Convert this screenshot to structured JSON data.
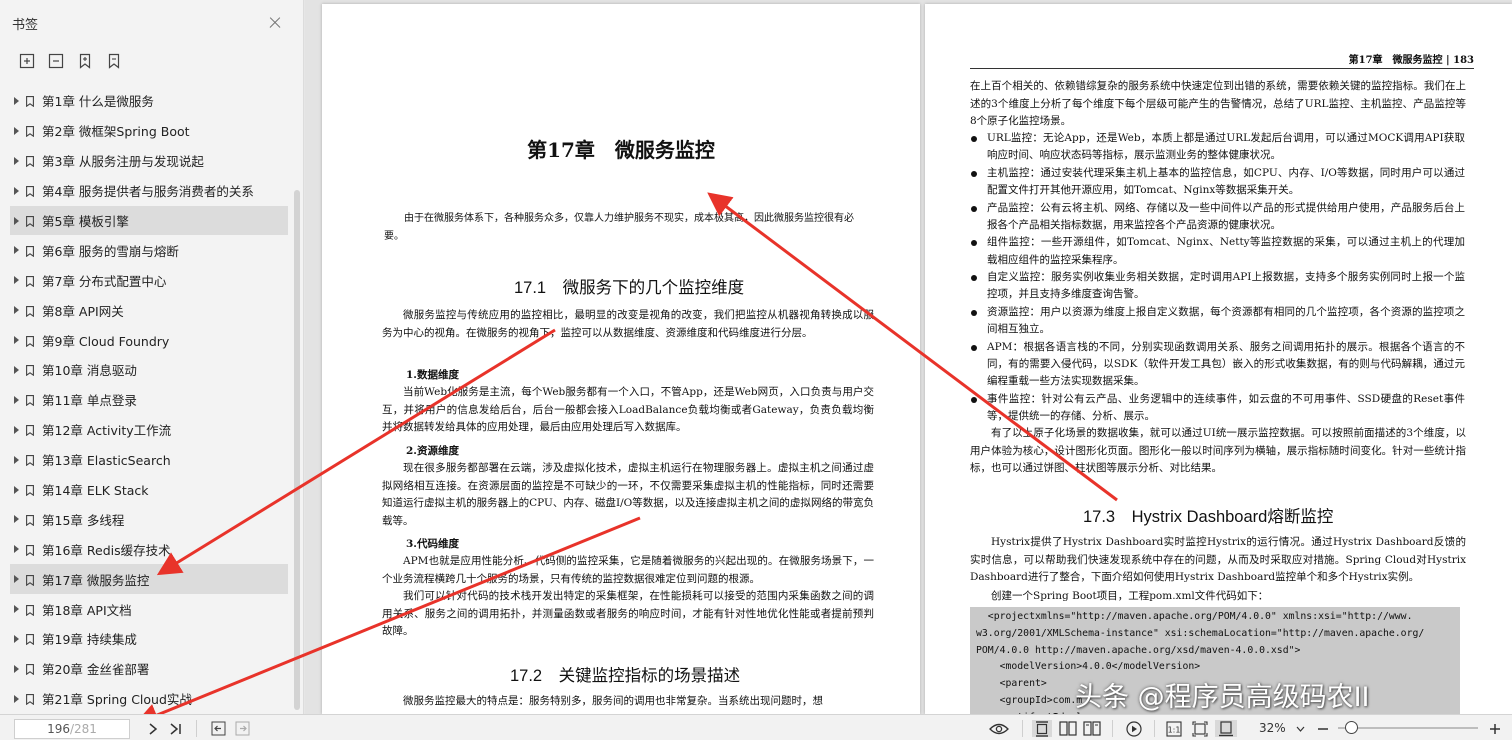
{
  "sidebar": {
    "title": "书签",
    "items": [
      {
        "label": "第1章 什么是微服务"
      },
      {
        "label": "第2章 微框架Spring Boot"
      },
      {
        "label": "第3章 从服务注册与发现说起"
      },
      {
        "label": "第4章 服务提供者与服务消费者的关系"
      },
      {
        "label": "第5章 模板引擎"
      },
      {
        "label": "第6章 服务的雪崩与熔断"
      },
      {
        "label": "第7章 分布式配置中心"
      },
      {
        "label": "第8章 API网关"
      },
      {
        "label": "第9章 Cloud Foundry"
      },
      {
        "label": "第10章 消息驱动"
      },
      {
        "label": "第11章 单点登录"
      },
      {
        "label": "第12章 Activity工作流"
      },
      {
        "label": "第13章 ElasticSearch"
      },
      {
        "label": "第14章 ELK Stack"
      },
      {
        "label": "第15章 多线程"
      },
      {
        "label": "第16章 Redis缓存技术"
      },
      {
        "label": "第17章 微服务监控"
      },
      {
        "label": "第18章 API文档"
      },
      {
        "label": "第19章 持续集成"
      },
      {
        "label": "第20章 金丝雀部署"
      },
      {
        "label": "第21章 Spring Cloud实战"
      }
    ]
  },
  "left_page": {
    "chapter_title": "第17章　微服务监控",
    "abstract": "由于在微服务体系下，各种服务众多，仅靠人力维护服务不现实，成本极其高，因此微服务监控很有必要。",
    "s1_title": "17.1　微服务下的几个监控维度",
    "s1_intro": "微服务监控与传统应用的监控相比，最明显的改变是视角的改变，我们把监控从机器视角转换成以服务为中心的视角。在微服务的视角下，监控可以从数据维度、资源维度和代码维度进行分层。",
    "sub1_title": "1.数据维度",
    "sub1_text": "当前Web化服务是主流，每个Web服务都有一个入口，不管App，还是Web网页，入口负责与用户交互，并将用户的信息发给后台，后台一般都会接入LoadBalance负载均衡或者Gateway，负责负载均衡并将数据转发给具体的应用处理，最后由应用处理后写入数据库。",
    "sub2_title": "2.资源维度",
    "sub2_text": "现在很多服务都部署在云端，涉及虚拟化技术，虚拟主机运行在物理服务器上。虚拟主机之间通过虚拟网络相互连接。在资源层面的监控是不可缺少的一环，不仅需要采集虚拟主机的性能指标，同时还需要知道运行虚拟主机的服务器上的CPU、内存、磁盘I/O等数据，以及连接虚拟主机之间的虚拟网络的带宽负载等。",
    "sub3_title": "3.代码维度",
    "sub3_text1": "APM也就是应用性能分析、代码侧的监控采集，它是随着微服务的兴起出现的。在微服务场景下，一个业务流程横跨几十个服务的场景，只有传统的监控数据很难定位到问题的根源。",
    "sub3_text2": "我们可以针对代码的技术栈开发出特定的采集框架，在性能损耗可以接受的范围内采集函数之间的调用关系、服务之间的调用拓扑，并测量函数或者服务的响应时间，才能有针对性地优化性能或者提前预判故障。",
    "s2_title": "17.2　关键监控指标的场景描述",
    "s2_text": "微服务监控最大的特点是：服务特别多，服务间的调用也非常复杂。当系统出现问题时，想"
  },
  "right_page": {
    "header": "第17章　微服务监控 | 183",
    "intro": "在上百个相关的、依赖错综复杂的服务系统中快速定位到出错的系统，需要依赖关键的监控指标。我们在上述的3个维度上分析了每个维度下每个层级可能产生的告警情况，总结了URL监控、主机监控、产品监控等8个原子化监控场景。",
    "bullets": [
      "URL监控：无论App，还是Web，本质上都是通过URL发起后台调用，可以通过MOCK调用API获取响应时间、响应状态码等指标，展示监测业务的整体健康状况。",
      "主机监控：通过安装代理采集主机上基本的监控信息，如CPU、内存、I/O等数据，同时用户可以通过配置文件打开其他开源应用，如Tomcat、Nginx等数据采集开关。",
      "产品监控：公有云将主机、网络、存储以及一些中间件以产品的形式提供给用户使用，产品服务后台上报各个产品相关指标数据，用来监控各个产品资源的健康状况。",
      "组件监控：一些开源组件，如Tomcat、Nginx、Netty等监控数据的采集，可以通过主机上的代理加载相应组件的监控采集程序。",
      "自定义监控：服务实例收集业务相关数据，定时调用API上报数据，支持多个服务实例同时上报一个监控项，并且支持多维度查询告警。",
      "资源监控：用户以资源为维度上报自定义数据，每个资源都有相同的几个监控项，各个资源的监控项之间相互独立。",
      "APM：根据各语言栈的不同，分别实现函数调用关系、服务之间调用拓扑的展示。根据各个语言的不同，有的需要入侵代码，以SDK（软件开发工具包）嵌入的形式收集数据，有的则与代码解耦，通过元编程重载一些方法实现数据采集。",
      "事件监控：针对公有云产品、业务逻辑中的连续事件，如云盘的不可用事件、SSD硬盘的Reset事件等，提供统一的存储、分析、展示。"
    ],
    "after_bullets": "有了以上原子化场景的数据收集，就可以通过UI统一展示监控数据。可以按照前面描述的3个维度，以用户体验为核心，设计图形化页面。图形化一般以时间序列为横轴，展示指标随时间变化。针对一些统计指标，也可以通过饼图、柱状图等展示分析、对比结果。",
    "s3_title": "17.3　Hystrix Dashboard熔断监控",
    "s3_text": "Hystrix提供了Hystrix Dashboard实时监控Hystrix的运行情况。通过Hystrix Dashboard反馈的实时信息，可以帮助我们快速发现系统中存在的问题，从而及时采取应对措施。Spring Cloud对Hystrix Dashboard进行了整合，下面介绍如何使用Hystrix Dashboard监控单个和多个Hystrix实例。",
    "s3_step": "创建一个Spring Boot项目，工程pom.xml文件代码如下：",
    "code": "  <projectxmlns=\"http://maven.apache.org/POM/4.0.0\" xmlns:xsi=\"http://www.\nw3.org/2001/XMLSchema-instance\" xsi:schemaLocation=\"http://maven.apache.org/\nPOM/4.0.0 http://maven.apache.org/xsd/maven-4.0.0.xsd\">\n    <modelVersion>4.0.0</modelVersion>\n    <parent>\n    <groupId>com.m\n    <artifactId>cl"
  },
  "watermark": "头条 @程序员高级码农II",
  "bottom": {
    "page_current": "196",
    "page_total": "/281",
    "zoom": "32%",
    "zoom_level": 0.05
  },
  "colors": {
    "annotation_arrow": "#e8332a",
    "active_item": "#dcdcdc"
  }
}
